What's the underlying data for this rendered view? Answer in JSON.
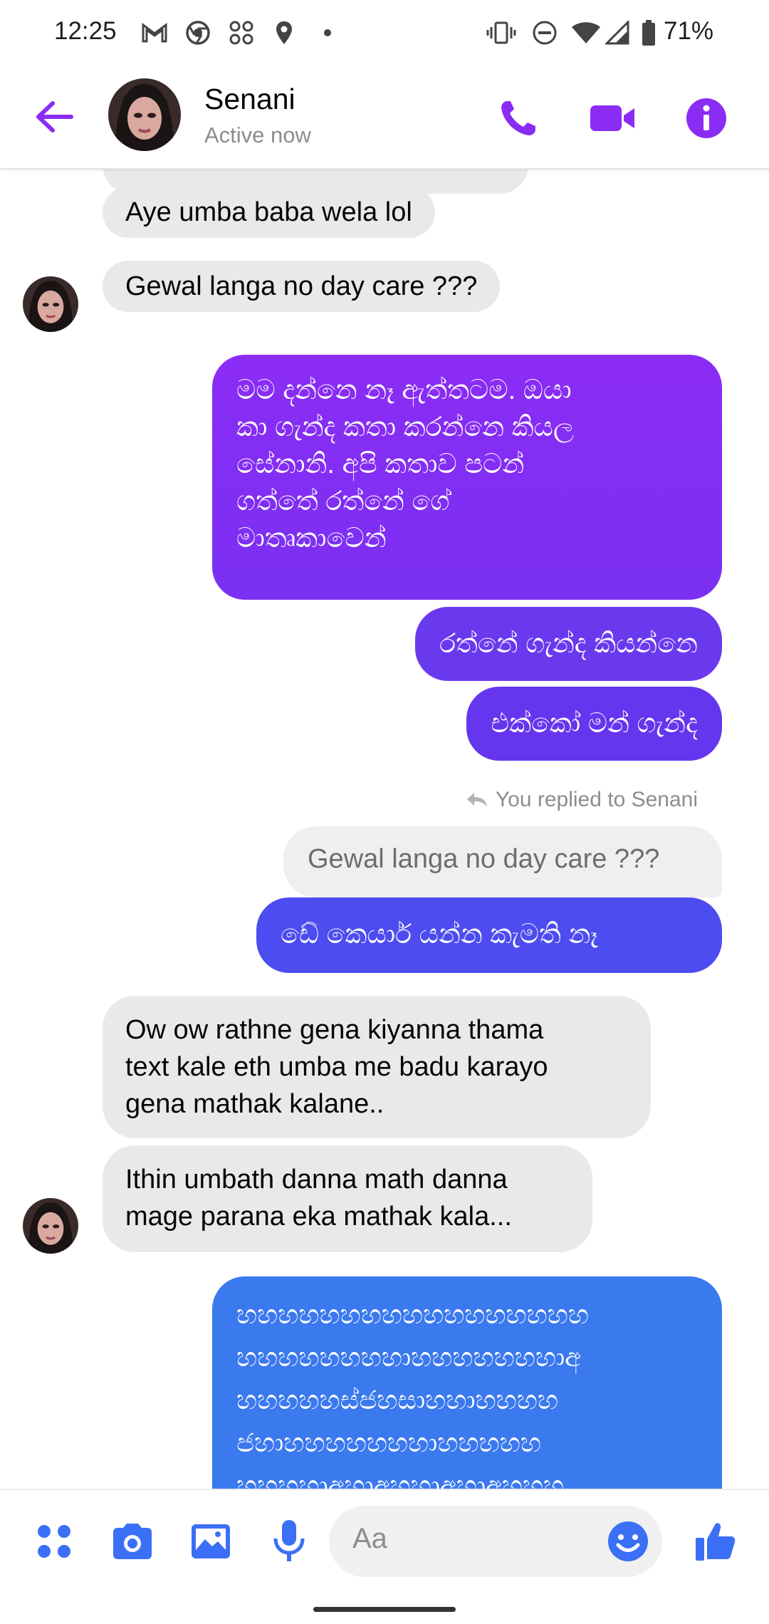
{
  "status_bar": {
    "time": "12:25",
    "battery": "71%",
    "icons": [
      "gmail-icon",
      "chrome-icon",
      "app-grid-icon",
      "location-icon",
      "dot-icon",
      "vibrate-icon",
      "dnd-icon",
      "wifi-icon",
      "signal-icon",
      "battery-icon"
    ]
  },
  "header": {
    "contact_name": "Senani",
    "contact_status": "Active now",
    "accent_color": "#8b2cf5"
  },
  "messages": {
    "m1": "Aye umba baba wela lol",
    "m2": "Gewal langa no day care ???",
    "m3_lines": [
      "මම දන්නෙ නෑ ඇත්තටම. ඔයා",
      "කා ගැන්ද කතා කරන්නෙ කියල",
      "සේනානි. අපි කතාව පටන්",
      "ගත්තේ රත්නේ  ගේ",
      "මාතෘකාවෙන්"
    ],
    "m4": "රත්නේ ගැන්ද කියන්නෙ",
    "m5": "එක්කෝ මන් ගැන්ද",
    "reply_note": "You replied to Senani",
    "quoted": "Gewal langa no day care ???",
    "m6": "ඩේ කෙයාර්  යන්න කැමති නෑ",
    "m7_lines": [
      "Ow ow rathne gena kiyanna thama",
      "text kale eth umba me badu karayo",
      "gena mathak kalane.."
    ],
    "m8_lines": [
      "Ithin umbath danna math danna",
      "mage parana eka mathak kala..."
    ],
    "m9_lines": [
      "හහහහහහහහහහහහහහහහහ",
      "හහහහහහහහාහහහහහහහාඅ",
      "හහහහහස්ජහසාහහාහහහහ",
      "ජහාහහහහහහහාහහහහහ",
      "හහහහාඅහාඅහහාඅහාඅහහහ"
    ]
  },
  "composer": {
    "placeholder": "Aa",
    "icons": [
      "menu-grid-icon",
      "camera-icon",
      "gallery-icon",
      "mic-icon",
      "emoji-icon",
      "like-icon"
    ]
  }
}
